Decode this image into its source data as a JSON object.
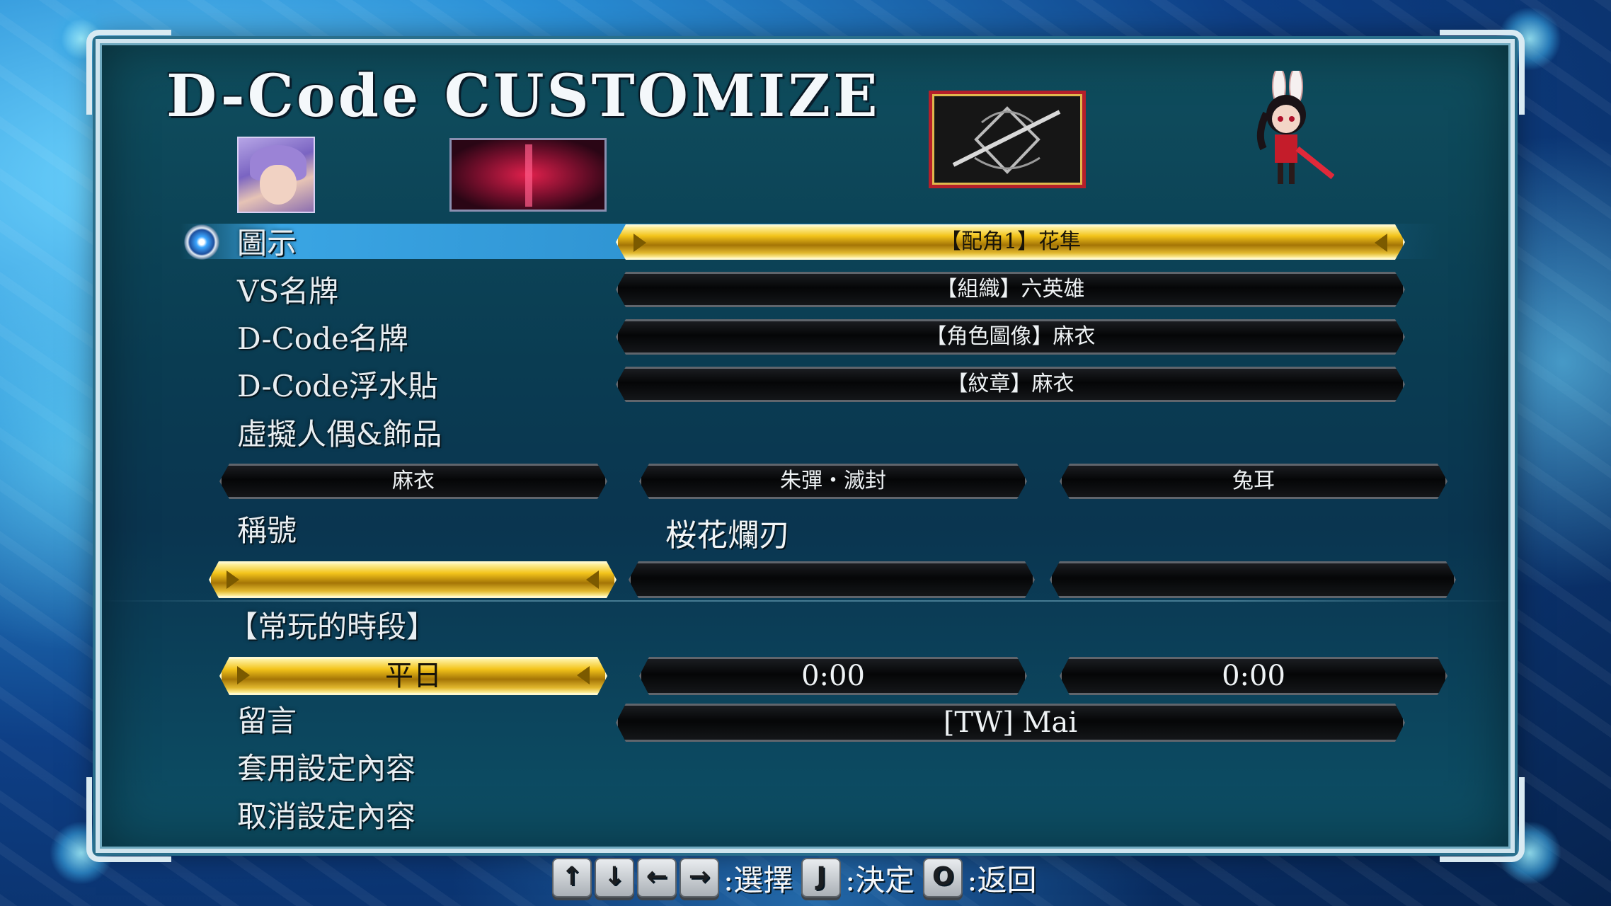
{
  "screen_title": "D-Code CUSTOMIZE",
  "rows": {
    "icon": {
      "label": "圖示",
      "value": "【配角1】花隼"
    },
    "vs_nameplate": {
      "label": "VS名牌",
      "value": "【組織】六英雄"
    },
    "dcode_nameplate": {
      "label": "D-Code名牌",
      "value": "【角色圖像】麻衣"
    },
    "dcode_emblem": {
      "label": "D-Code浮水貼",
      "value": "【紋章】麻衣"
    },
    "avatar": {
      "label": "虛擬人偶&飾品",
      "options": [
        "麻衣",
        "朱彈・滅封",
        "兔耳"
      ]
    },
    "title": {
      "label": "稱號",
      "value": "桜花爛刃"
    },
    "playtime": {
      "label": "【常玩的時段】",
      "day": "平日",
      "from": "0:00",
      "to": "0:00"
    },
    "message": {
      "label": "留言",
      "value": "[TW] Mai"
    },
    "apply": {
      "label": "套用設定內容"
    },
    "cancel": {
      "label": "取消設定內容"
    }
  },
  "controls": {
    "keys_select": [
      "↑",
      "↓",
      "←",
      "→"
    ],
    "select_label": ":選擇",
    "confirm_key": "J",
    "confirm_label": ":決定",
    "back_key": "O",
    "back_label": ":返回"
  },
  "colors": {
    "highlight_gold": "#f3c41b",
    "selection_blue": "#3caaeb",
    "panel_bg": "#0a3c52"
  }
}
